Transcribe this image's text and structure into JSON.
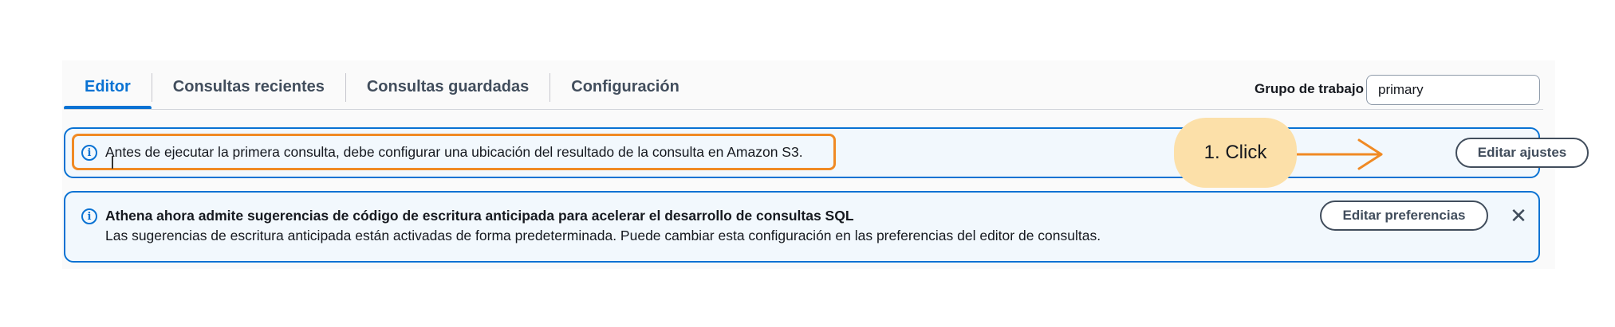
{
  "tabs": [
    {
      "label": "Editor",
      "active": true
    },
    {
      "label": "Consultas recientes",
      "active": false
    },
    {
      "label": "Consultas guardadas",
      "active": false
    },
    {
      "label": "Configuración",
      "active": false
    }
  ],
  "workgroup": {
    "label": "Grupo de trabajo",
    "value": "primary"
  },
  "alerts": {
    "s3": {
      "icon": "info-icon",
      "text": "Antes de ejecutar la primera consulta, debe configurar una ubicación del resultado de la consulta en Amazon S3.",
      "button_label": "Editar ajustes"
    },
    "suggestions": {
      "icon": "info-icon",
      "title": "Athena ahora admite sugerencias de código de escritura anticipada para acelerar el desarrollo de consultas SQL",
      "body": "Las sugerencias de escritura anticipada están activadas de forma predeterminada. Puede cambiar esta configuración en las preferencias del editor de consultas.",
      "button_label": "Editar preferencias",
      "close_icon": "close-icon"
    }
  },
  "annotation": {
    "callout_text": "1. Click",
    "highlight_color": "#f08a24",
    "callout_color": "#fce0a9"
  },
  "colors": {
    "accent": "#0972d3",
    "alert_background": "#f2f8fd"
  }
}
